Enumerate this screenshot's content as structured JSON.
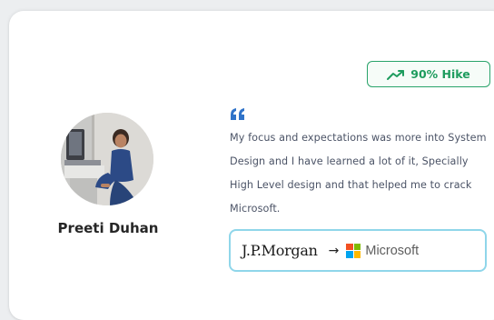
{
  "card": {
    "badge": {
      "label": "90% Hike",
      "icon": "trending-up-icon",
      "color": "#1e9c5e"
    },
    "person": {
      "name": "Preeti Duhan",
      "avatar_icon": "profile-photo"
    },
    "testimonial": {
      "quote_icon": "quote-icon",
      "text": "My focus and expectations was more into System Design and I have learned a lot of it, Specially High Level design and that helped me to crack Microsoft."
    },
    "transition": {
      "from": "J.P.Morgan",
      "arrow": "→",
      "to": "Microsoft",
      "to_logo_colors": [
        "#f25022",
        "#7fba00",
        "#00a4ef",
        "#ffb900"
      ]
    }
  }
}
